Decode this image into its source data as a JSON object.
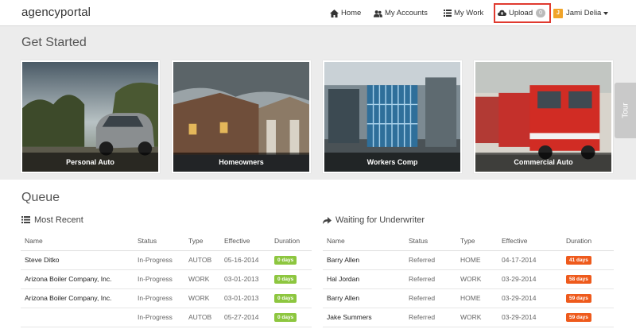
{
  "navbar": {
    "brand": "agencyportal",
    "home_label": "Home",
    "accounts_label": "My Accounts",
    "mywork_label": "My Work",
    "upload_label": "Upload",
    "upload_count": "0",
    "user_initial": "J",
    "user_name": "Jami Delia"
  },
  "get_started": {
    "title": "Get Started",
    "cards": [
      {
        "label": "Personal Auto"
      },
      {
        "label": "Homeowners"
      },
      {
        "label": "Workers Comp"
      },
      {
        "label": "Commercial Auto"
      }
    ]
  },
  "tour": {
    "label": "Tour"
  },
  "queue": {
    "title": "Queue",
    "most_recent": {
      "title": "Most Recent",
      "columns": [
        "Name",
        "Status",
        "Type",
        "Effective",
        "Duration"
      ],
      "rows": [
        {
          "name": "Steve Ditko",
          "status": "In-Progress",
          "type": "AUTOB",
          "effective": "05-16-2014",
          "duration": "0 days"
        },
        {
          "name": "Arizona Boiler Company, Inc.",
          "status": "In-Progress",
          "type": "WORK",
          "effective": "03-01-2013",
          "duration": "0 days"
        },
        {
          "name": "Arizona Boiler Company, Inc.",
          "status": "In-Progress",
          "type": "WORK",
          "effective": "03-01-2013",
          "duration": "0 days"
        },
        {
          "name": "",
          "status": "In-Progress",
          "type": "AUTOB",
          "effective": "05-27-2014",
          "duration": "0 days"
        }
      ]
    },
    "waiting": {
      "title": "Waiting for Underwriter",
      "columns": [
        "Name",
        "Status",
        "Type",
        "Effective",
        "Duration"
      ],
      "rows": [
        {
          "name": "Barry Allen",
          "status": "Referred",
          "type": "HOME",
          "effective": "04-17-2014",
          "duration": "41 days"
        },
        {
          "name": "Hal Jordan",
          "status": "Referred",
          "type": "WORK",
          "effective": "03-29-2014",
          "duration": "58 days"
        },
        {
          "name": "Barry Allen",
          "status": "Referred",
          "type": "HOME",
          "effective": "03-29-2014",
          "duration": "59 days"
        },
        {
          "name": "Jake Summers",
          "status": "Referred",
          "type": "WORK",
          "effective": "03-29-2014",
          "duration": "59 days"
        }
      ]
    }
  },
  "colors": {
    "upload_highlight": "#e03a2f",
    "duration_green": "#8dc63f",
    "duration_orange": "#ee5a1c",
    "avatar": "#f0a42a"
  },
  "icons": {
    "home": "home-icon",
    "accounts": "users-icon",
    "mywork": "list-icon",
    "upload": "cloud-upload-icon",
    "most_recent": "list-icon",
    "waiting": "share-arrow-icon"
  }
}
